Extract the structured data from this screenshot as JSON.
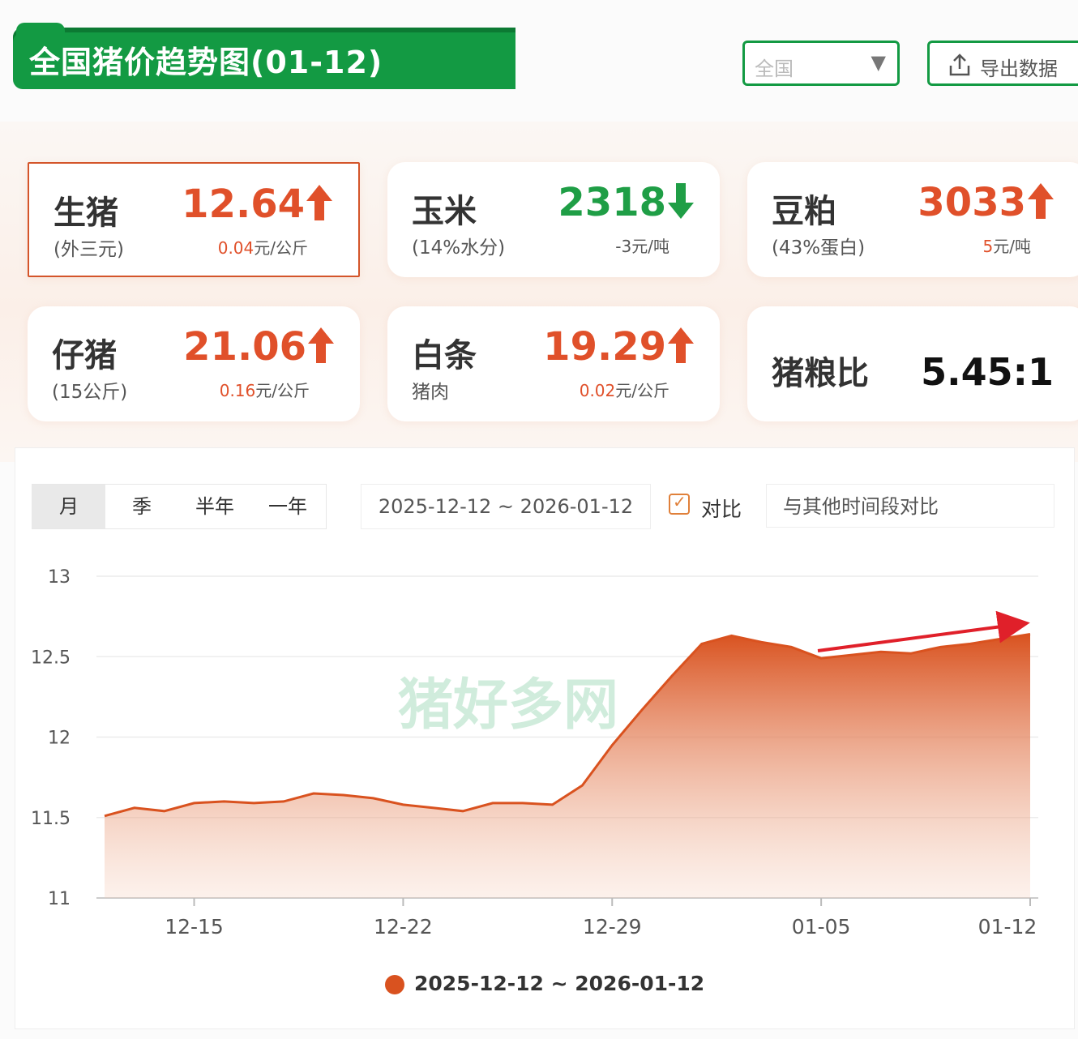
{
  "header": {
    "title": "全国猪价趋势图(01-12)",
    "region_select": "全国",
    "export_label": "导出数据"
  },
  "cards": {
    "live_hog": {
      "name": "生猪",
      "sub": "(外三元)",
      "price": "12.64",
      "change": "0.04",
      "unit": "元/公斤",
      "trend": "up"
    },
    "corn": {
      "name": "玉米",
      "sub": "(14%水分)",
      "price": "2318",
      "change": "-3",
      "unit": "元/吨",
      "trend": "down"
    },
    "soymeal": {
      "name": "豆粕",
      "sub": "(43%蛋白)",
      "price": "3033",
      "change": "5",
      "unit": "元/吨",
      "trend": "up"
    },
    "piglet": {
      "name": "仔猪",
      "sub": "(15公斤)",
      "price": "21.06",
      "change": "0.16",
      "unit": "元/公斤",
      "trend": "up"
    },
    "pork": {
      "name": "白条",
      "sub": "猪肉",
      "price": "19.29",
      "change": "0.02",
      "unit": "元/公斤",
      "trend": "up"
    },
    "ratio": {
      "name": "猪粮比",
      "value": "5.45:1"
    }
  },
  "controls": {
    "range_tabs": [
      "月",
      "季",
      "半年",
      "一年"
    ],
    "active_tab": "月",
    "date_range": "2025-12-12 ~ 2026-01-12",
    "compare_label": "对比",
    "compare_placeholder": "与其他时间段对比"
  },
  "watermark": "猪好多网",
  "colors": {
    "brand_green": "#139a43",
    "up_red": "#e0502a",
    "down_green": "#1f9e46",
    "series": "#d9521f",
    "trend_arrow": "#e0202a"
  },
  "chart_data": {
    "type": "area",
    "x": [
      "2025-12-12",
      "2025-12-13",
      "2025-12-14",
      "2025-12-15",
      "2025-12-16",
      "2025-12-17",
      "2025-12-18",
      "2025-12-19",
      "2025-12-20",
      "2025-12-21",
      "2025-12-22",
      "2025-12-23",
      "2025-12-24",
      "2025-12-25",
      "2025-12-26",
      "2025-12-27",
      "2025-12-28",
      "2025-12-29",
      "2025-12-30",
      "2025-12-31",
      "2026-01-01",
      "2026-01-02",
      "2026-01-03",
      "2026-01-04",
      "2026-01-05",
      "2026-01-06",
      "2026-01-07",
      "2026-01-08",
      "2026-01-09",
      "2026-01-10",
      "2026-01-11",
      "2026-01-12"
    ],
    "series": [
      {
        "name": "2025-12-12 ~ 2026-01-12",
        "values": [
          11.51,
          11.56,
          11.54,
          11.59,
          11.6,
          11.59,
          11.6,
          11.65,
          11.64,
          11.62,
          11.58,
          11.56,
          11.54,
          11.59,
          11.59,
          11.58,
          11.7,
          11.95,
          12.17,
          12.38,
          12.58,
          12.63,
          12.59,
          12.56,
          12.49,
          12.51,
          12.53,
          12.52,
          12.56,
          12.58,
          12.61,
          12.64
        ]
      }
    ],
    "xticks": [
      "12-15",
      "12-22",
      "12-29",
      "01-05",
      "01-12"
    ],
    "yticks": [
      11,
      11.5,
      12,
      12.5,
      13
    ],
    "ylim": [
      11,
      13
    ],
    "grid": true,
    "legend": "bottom-center",
    "annotation": "trend-arrow-up"
  }
}
